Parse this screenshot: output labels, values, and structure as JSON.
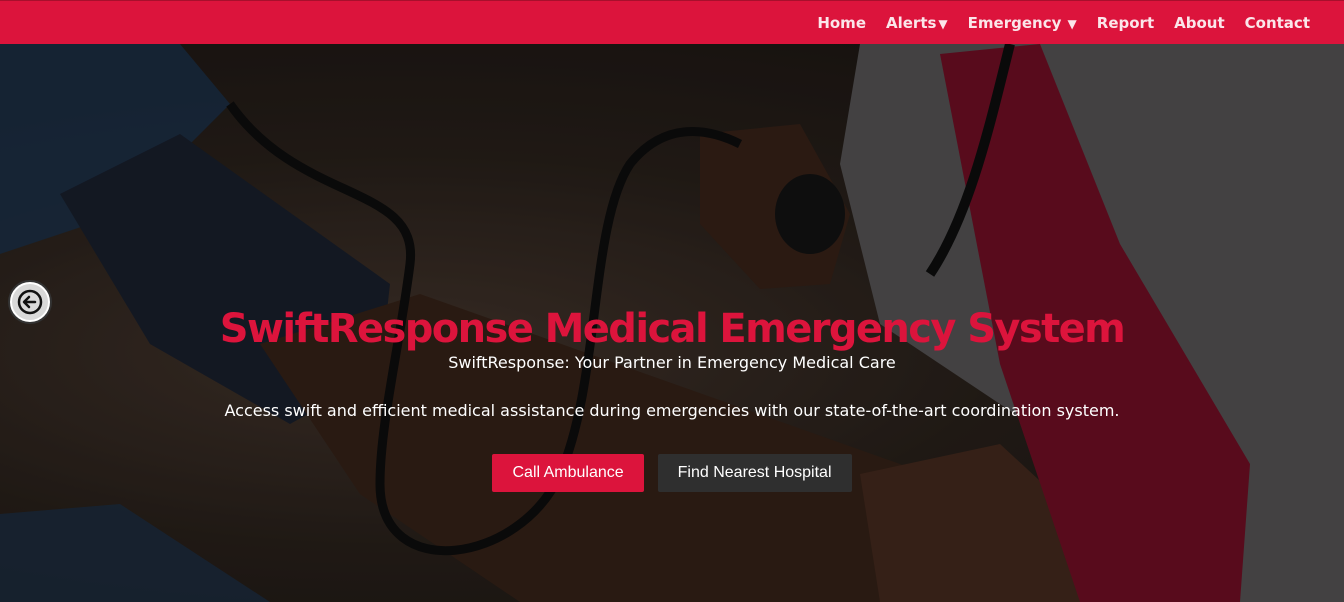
{
  "nav": {
    "items": [
      {
        "label": "Home",
        "caret": ""
      },
      {
        "label": "Alerts",
        "caret": "▼"
      },
      {
        "label": "Emergency",
        "caret": " ▼"
      },
      {
        "label": "Report",
        "caret": ""
      },
      {
        "label": "About",
        "caret": ""
      },
      {
        "label": "Contact",
        "caret": ""
      }
    ]
  },
  "hero": {
    "title": "SwiftResponse Medical Emergency System",
    "subtitle": "SwiftResponse: Your Partner in Emergency Medical Care",
    "description": "Access swift and efficient medical assistance during emergencies with our state-of-the-art coordination system.",
    "primary_button": "Call Ambulance",
    "secondary_button": "Find Nearest Hospital",
    "prev_arrow_icon": "arrow-left-circle-icon"
  },
  "colors": {
    "brand_red": "#dc143c",
    "dark_button": "#2f2f2f"
  }
}
